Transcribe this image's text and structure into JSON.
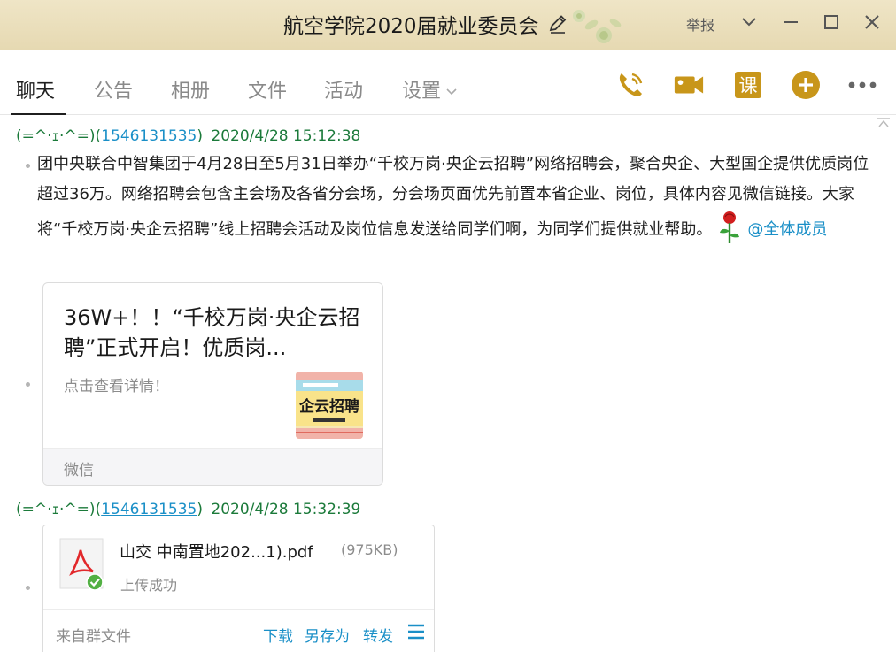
{
  "window": {
    "title": "航空学院2020届就业委员会",
    "report_label": "举报"
  },
  "tabs": [
    {
      "label": "聊天",
      "active": true
    },
    {
      "label": "公告",
      "active": false
    },
    {
      "label": "相册",
      "active": false
    },
    {
      "label": "文件",
      "active": false
    },
    {
      "label": "活动",
      "active": false
    },
    {
      "label": "设置",
      "active": false
    }
  ],
  "toolbar": {
    "icons": [
      "phone-icon",
      "video-icon",
      "course-icon",
      "add-icon",
      "more-icon"
    ],
    "course_glyph": "课",
    "accent_color": "#c8961a"
  },
  "messages": [
    {
      "sender_prefix": "(=^·ｪ·^=)(",
      "sender_id": "1546131535",
      "sender_suffix": ")",
      "time": "2020/4/28 15:12:38",
      "text": "团中央联合中智集团于4月28日至5月31日举办“千校万岗·央企云招聘”网络招聘会，聚合央企、大型国企提供优质岗位超过36万。网络招聘会包含主会场及各省分会场，分会场页面优先前置本省企业、岗位，具体内容见微信链接。大家将“千校万岗·央企云招聘”线上招聘会活动及岗位信息发送给同学们啊，为同学们提供就业帮助。",
      "mention": "@全体成员",
      "card": {
        "title": "36W+！！“千校万岗·央企云招聘”正式开启！优质岗...",
        "description": "点击查看详情！",
        "thumb_text": "企云招聘",
        "source": "微信"
      }
    },
    {
      "sender_prefix": "(=^·ｪ·^=)(",
      "sender_id": "1546131535",
      "sender_suffix": ")",
      "time": "2020/4/28 15:32:39",
      "file": {
        "name": "山交 中南置地202...1).pdf",
        "size": "(975KB)",
        "status": "上传成功",
        "origin": "来自群文件",
        "actions": [
          "下载",
          "另存为",
          "转发"
        ]
      }
    }
  ]
}
